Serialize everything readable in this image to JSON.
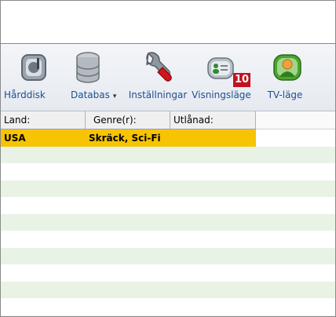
{
  "toolbar": {
    "buttons": [
      {
        "label": "Hårddisk",
        "icon": "hard-disk-icon"
      },
      {
        "label": "Databas",
        "icon": "database-icon",
        "dropdown": true
      },
      {
        "label": "Inställningar",
        "icon": "wrench-icon"
      },
      {
        "label": "Visningsläge",
        "icon": "view-mode-icon"
      },
      {
        "label": "TV-läge",
        "icon": "tv-mode-icon"
      }
    ],
    "badge": "10"
  },
  "table": {
    "columns": [
      "Land:",
      "Genre(r):",
      "Utlånad:"
    ],
    "selected_row": {
      "land": "USA",
      "genre": "Skräck, Sci-Fi",
      "utlanad": ""
    }
  },
  "colors": {
    "selection": "#f7c403",
    "alt_row": "#e8f3e6",
    "label": "#1b4f91",
    "badge": "#c1121f"
  }
}
